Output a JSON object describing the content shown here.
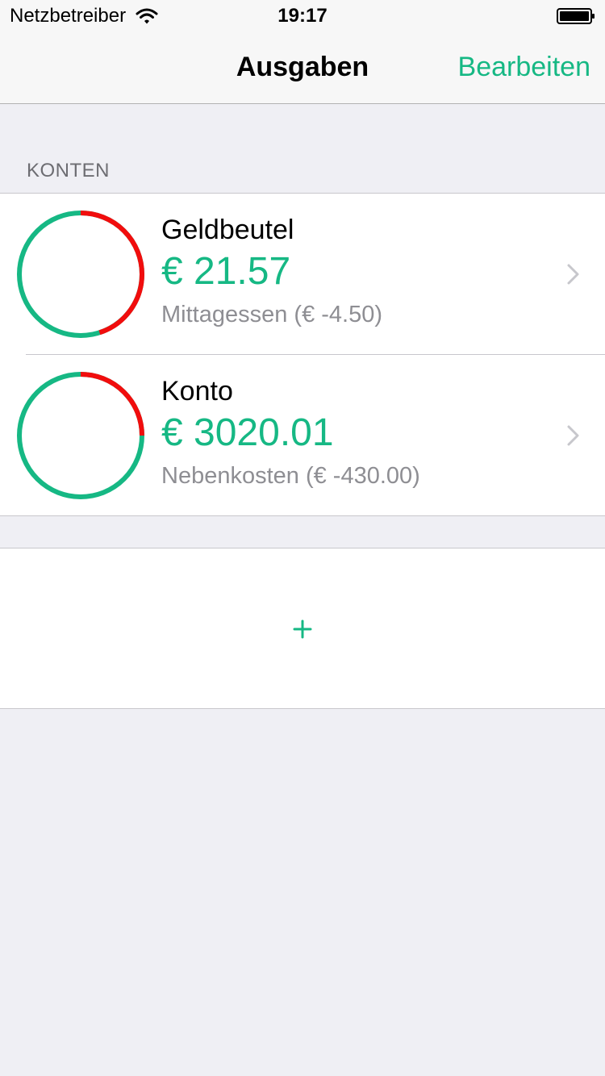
{
  "status": {
    "carrier": "Netzbetreiber",
    "time": "19:17",
    "battery_percent": 100
  },
  "nav": {
    "title": "Ausgaben",
    "edit_label": "Bearbeiten"
  },
  "section": {
    "header": "KONTEN"
  },
  "accounts": [
    {
      "name": "Geldbeutel",
      "balance": "€ 21.57",
      "last_expense": "Mittagessen (€ -4.50)",
      "spent_fraction": 0.45
    },
    {
      "name": "Konto",
      "balance": "€ 3020.01",
      "last_expense": "Nebenkosten (€ -430.00)",
      "spent_fraction": 0.25
    }
  ],
  "add": {
    "icon": "plus-icon"
  },
  "colors": {
    "accent": "#16b884",
    "spent": "#f10d0d"
  }
}
